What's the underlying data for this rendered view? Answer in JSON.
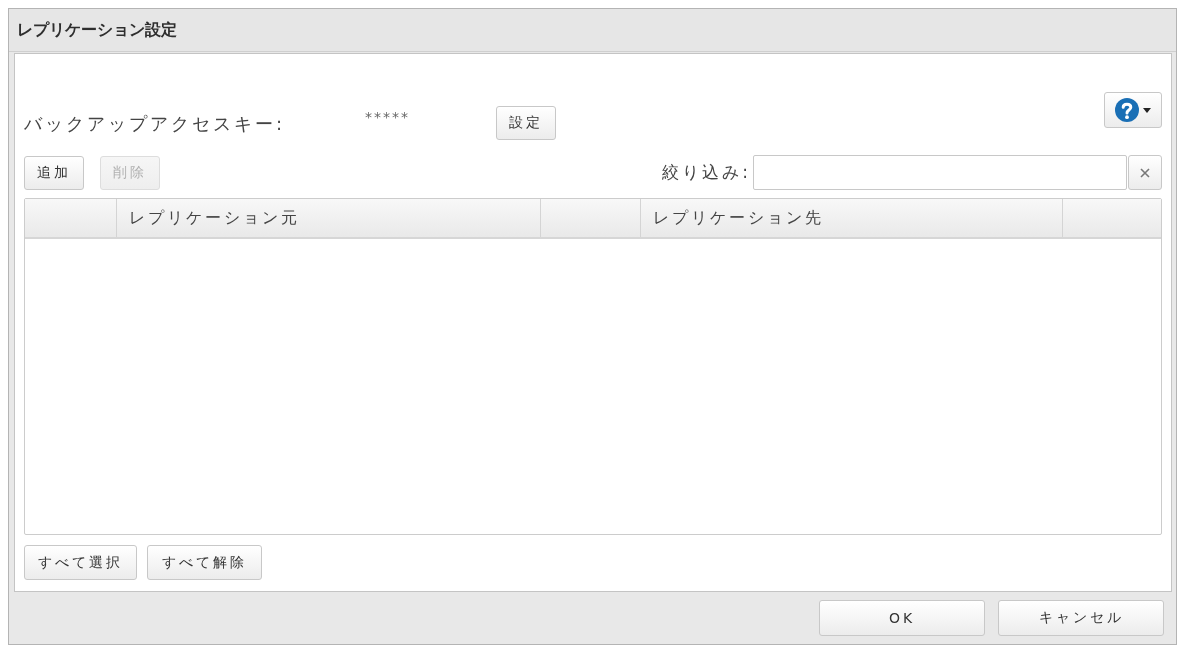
{
  "dialog": {
    "title": "レプリケーション設定"
  },
  "access_key": {
    "label": "バックアップアクセスキー:",
    "value": "*****",
    "button": "設定"
  },
  "toolbar": {
    "buttons": [
      {
        "label": "追加",
        "disabled": false
      },
      {
        "label": "削除",
        "disabled": true
      }
    ],
    "filter": {
      "label": "絞り込み:"
    }
  },
  "table": {
    "columns": [
      {
        "kind": "blank"
      },
      {
        "kind": "text",
        "label": "レプリケーション元"
      },
      {
        "kind": "blank"
      },
      {
        "kind": "text",
        "label": "レプリケーション先"
      },
      {
        "kind": "blank"
      }
    ]
  },
  "selection_buttons": [
    "すべて選択",
    "すべて解除"
  ],
  "footer_buttons": [
    "OK",
    "キャンセル"
  ]
}
